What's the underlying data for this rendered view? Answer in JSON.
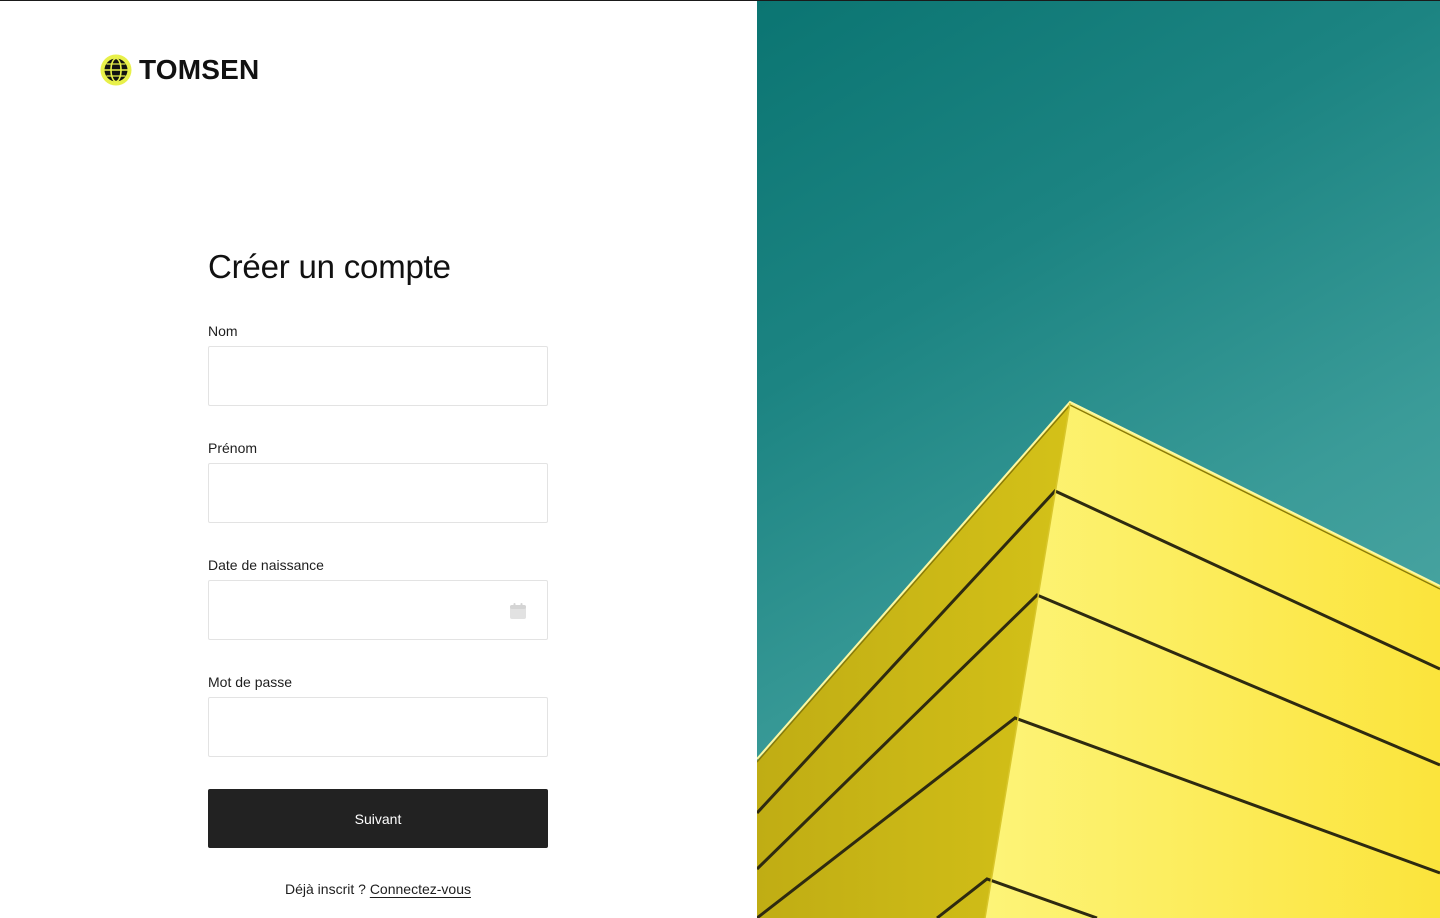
{
  "brand": {
    "name": "TOMSEN",
    "accent_color": "#e8f04a"
  },
  "form": {
    "title": "Créer un compte",
    "fields": [
      {
        "label": "Nom",
        "value": "",
        "type": "text"
      },
      {
        "label": "Prénom",
        "value": "",
        "type": "text"
      },
      {
        "label": "Date de naissance",
        "value": "",
        "type": "date",
        "icon": "calendar-icon"
      },
      {
        "label": "Mot de passe",
        "value": "",
        "type": "password"
      }
    ],
    "submit_label": "Suivant",
    "login_prompt": "Déjà inscrit ?",
    "login_link": "Connectez-vous"
  },
  "hero": {
    "sky_color": "#1c8482",
    "building_color": "#f5e64a"
  }
}
